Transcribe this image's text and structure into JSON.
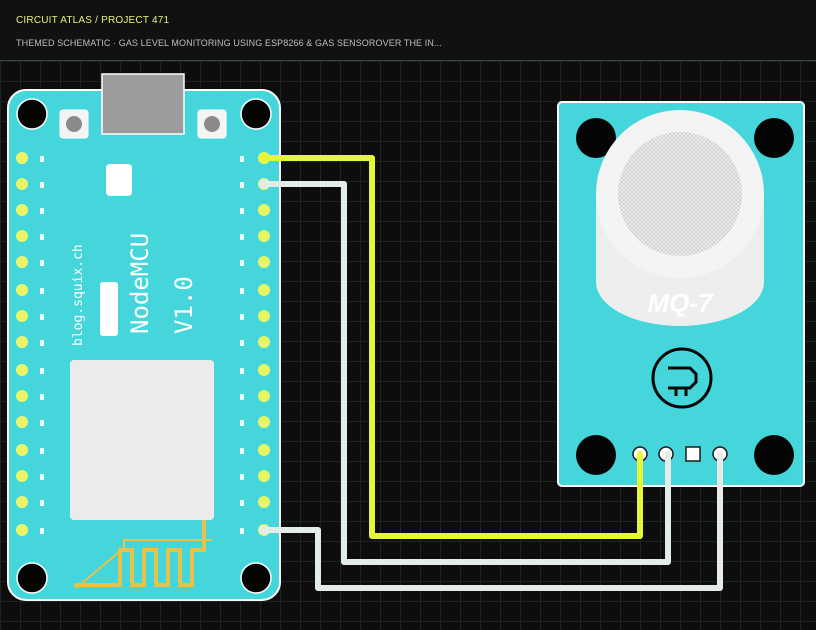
{
  "header": {
    "title": "CIRCUIT ATLAS / PROJECT 471",
    "subtitle": "THEMED SCHEMATIC · GAS LEVEL MONITORING USING ESP8266 & GAS SENSOROVER THE IN..."
  },
  "board": {
    "name_label": "NodeMCU",
    "version_label": "V1.0",
    "site_label": "blog.squix.ch",
    "color": "#45d6dc"
  },
  "sensor": {
    "model_label": "MQ-7",
    "color": "#45d6dc"
  },
  "wires": {
    "signal_color": "#e6f73a",
    "power_color": "#e4ece9"
  }
}
